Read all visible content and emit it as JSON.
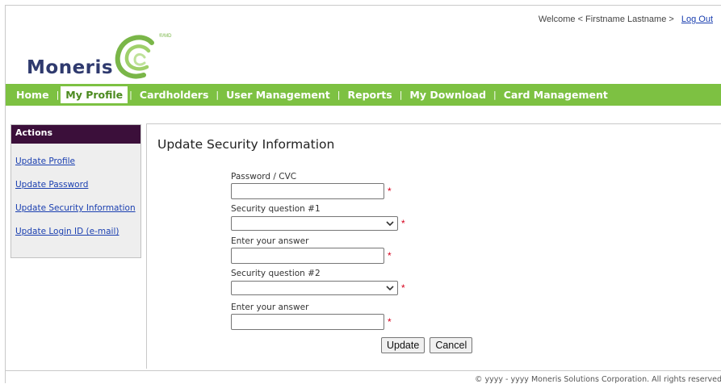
{
  "header": {
    "welcome_text": "Welcome < Firstname Lastname >",
    "logout_label": "Log Out"
  },
  "logo": {
    "wordmark": "Moneris",
    "trademark": "®/MD",
    "icon": "moneris-swirl-icon",
    "color": "#7ab648"
  },
  "nav": {
    "items": [
      {
        "label": "Home"
      },
      {
        "label": "My Profile"
      },
      {
        "label": "Cardholders"
      },
      {
        "label": "User Management"
      },
      {
        "label": "Reports"
      },
      {
        "label": "My Download"
      },
      {
        "label": "Card Management"
      }
    ],
    "active": "My Profile",
    "bar_color": "#7dc142"
  },
  "sidebar": {
    "title": "Actions",
    "links": [
      {
        "label": "Update Profile"
      },
      {
        "label": "Update Password"
      },
      {
        "label": "Update Security Information"
      },
      {
        "label": "Update Login ID (e-mail)"
      }
    ],
    "header_color": "#3b0f3a"
  },
  "main": {
    "title": "Update Security Information",
    "fields": {
      "password_label": "Password / CVC",
      "password_value": "",
      "question1_label": "Security question #1",
      "question1_value": "",
      "answer1_label": "Enter your answer",
      "answer1_value": "",
      "question2_label": "Security question #2",
      "question2_value": "",
      "answer2_label": "Enter your answer",
      "answer2_value": "",
      "required_mark": "*"
    },
    "buttons": {
      "update": "Update",
      "cancel": "Cancel"
    }
  },
  "footer": {
    "text": "©  yyyy - yyyy   Moneris Solutions Corporation. All rights reserved"
  }
}
